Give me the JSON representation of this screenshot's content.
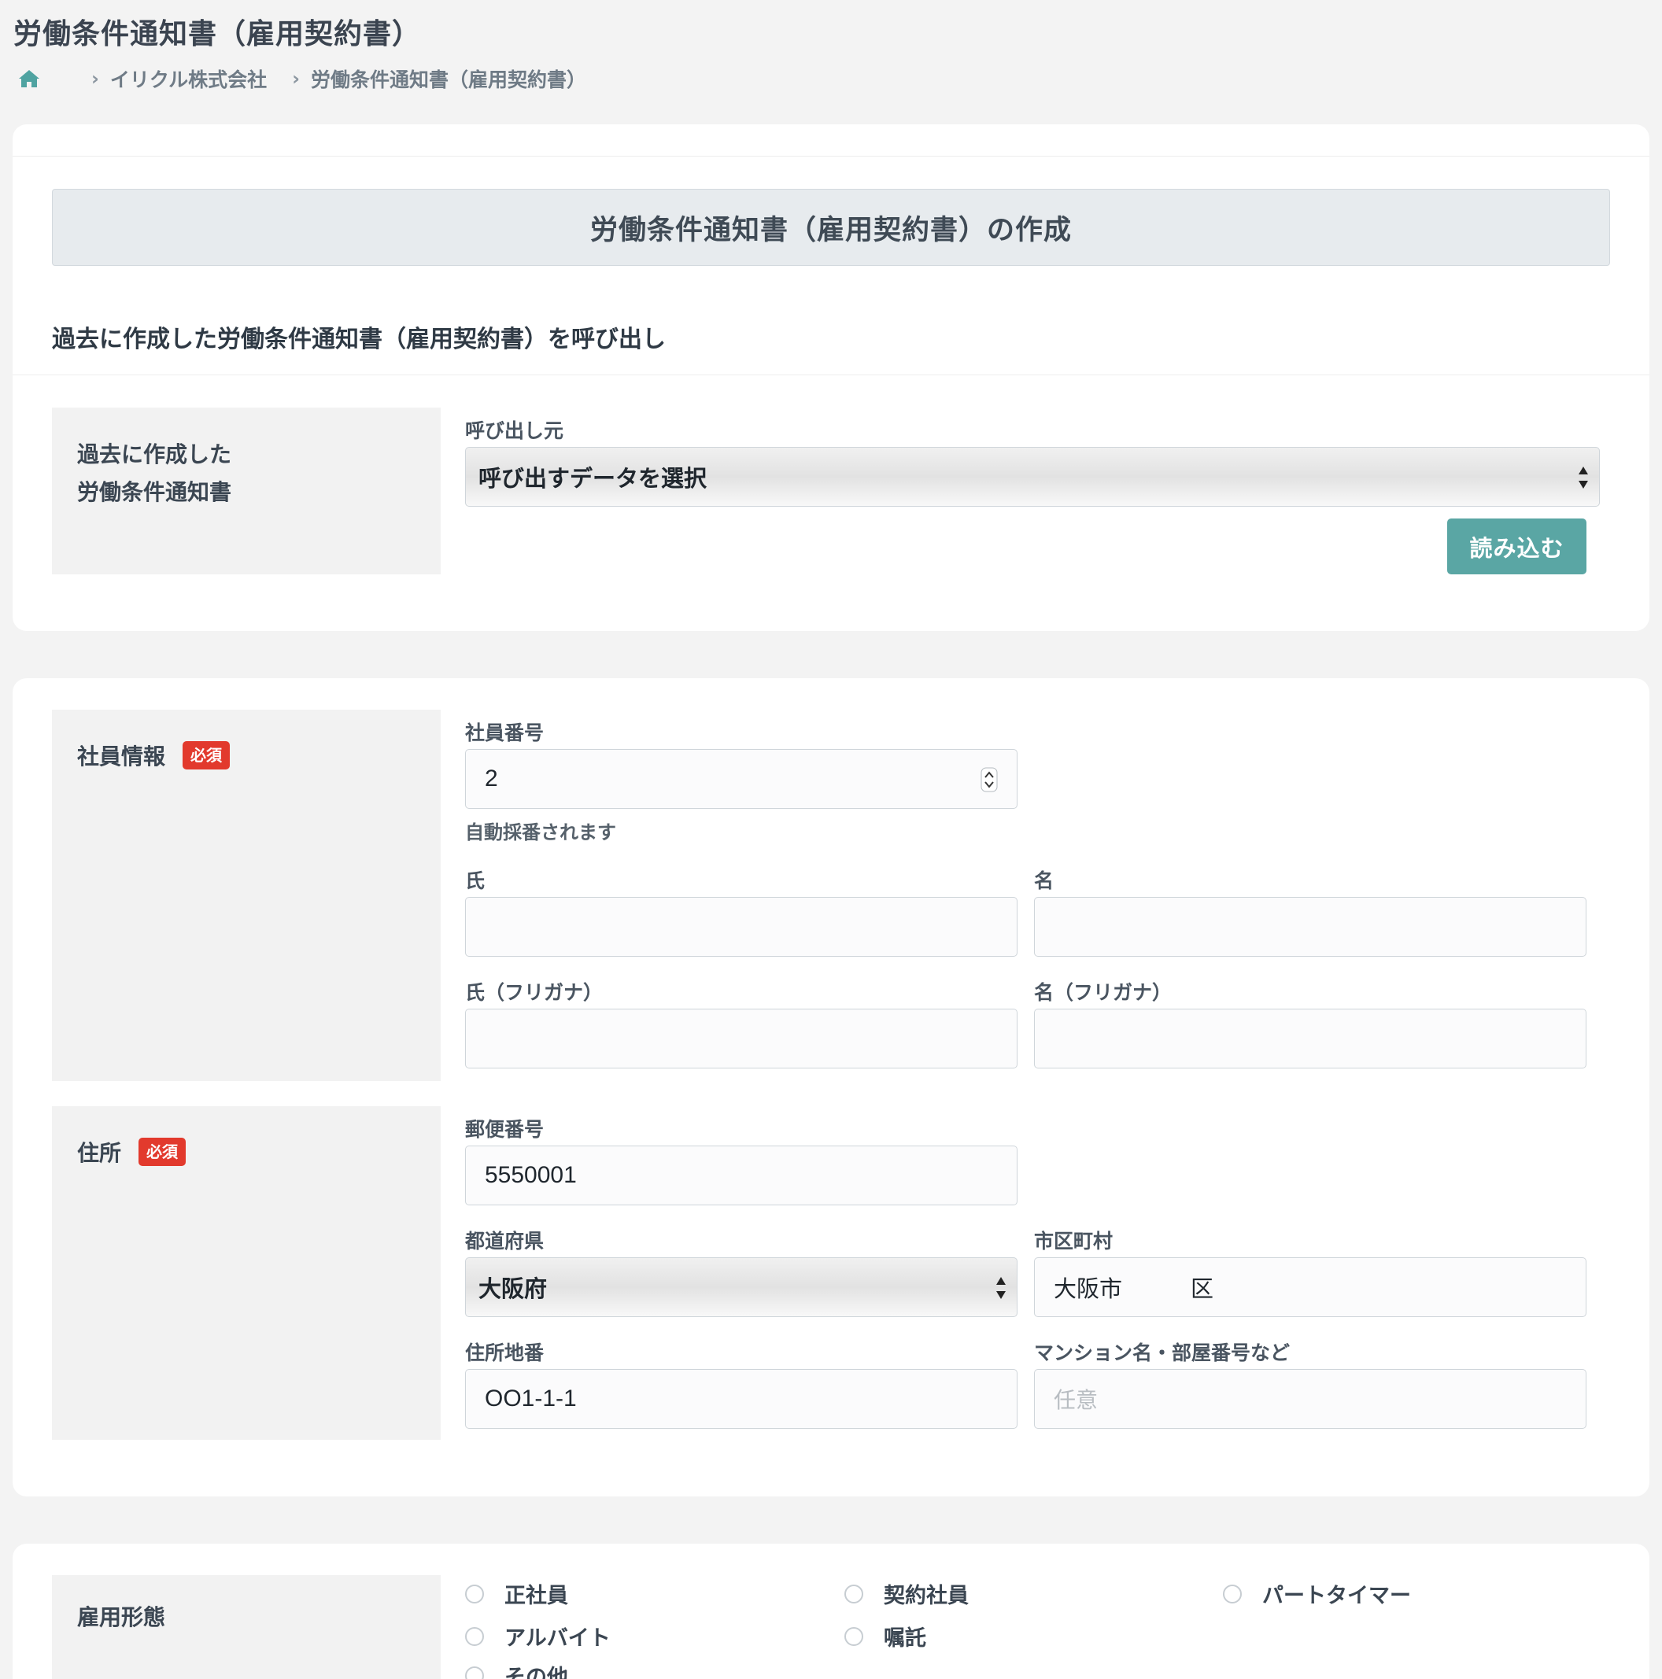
{
  "page": {
    "title": "労働条件通知書（雇用契約書）",
    "breadcrumb": {
      "company": "イリクル株式会社",
      "current": "労働条件通知書（雇用契約書）"
    }
  },
  "card1": {
    "banner": "労働条件通知書（雇用契約書）の作成",
    "section_heading": "過去に作成した労働条件通知書（雇用契約書）を呼び出し",
    "label_line1": "過去に作成した",
    "label_line2": "労働条件通知書",
    "source_label": "呼び出し元",
    "source_select_value": "呼び出すデータを選択",
    "load_button": "読み込む"
  },
  "employee": {
    "label": "社員情報",
    "required_badge": "必須",
    "number_label": "社員番号",
    "number_value": "2",
    "number_hint": "自動採番されます",
    "last_name_label": "氏",
    "first_name_label": "名",
    "last_name_kana_label": "氏（フリガナ）",
    "first_name_kana_label": "名（フリガナ）"
  },
  "address": {
    "label": "住所",
    "required_badge": "必須",
    "postal_label": "郵便番号",
    "postal_value": "5550001",
    "prefecture_label": "都道府県",
    "prefecture_value": "大阪府",
    "city_label": "市区町村",
    "city_value": "大阪市　　　区",
    "street_label": "住所地番",
    "street_value": "OO1-1-1",
    "building_label": "マンション名・部屋番号など",
    "building_placeholder": "任意"
  },
  "employment": {
    "label": "雇用形態",
    "options": [
      "正社員",
      "契約社員",
      "パートタイマー",
      "アルバイト",
      "嘱託",
      "その他"
    ]
  },
  "colors": {
    "accent_button": "#5aa6a4",
    "badge": "#e23a2d",
    "home_icon": "#4fa3a1"
  },
  "icons": {
    "home": "home-icon",
    "breadcrumb_separator": "chevron-right-icon",
    "select_arrows": "sort-arrows-icon",
    "spinner": "spinner-arrows-icon"
  }
}
